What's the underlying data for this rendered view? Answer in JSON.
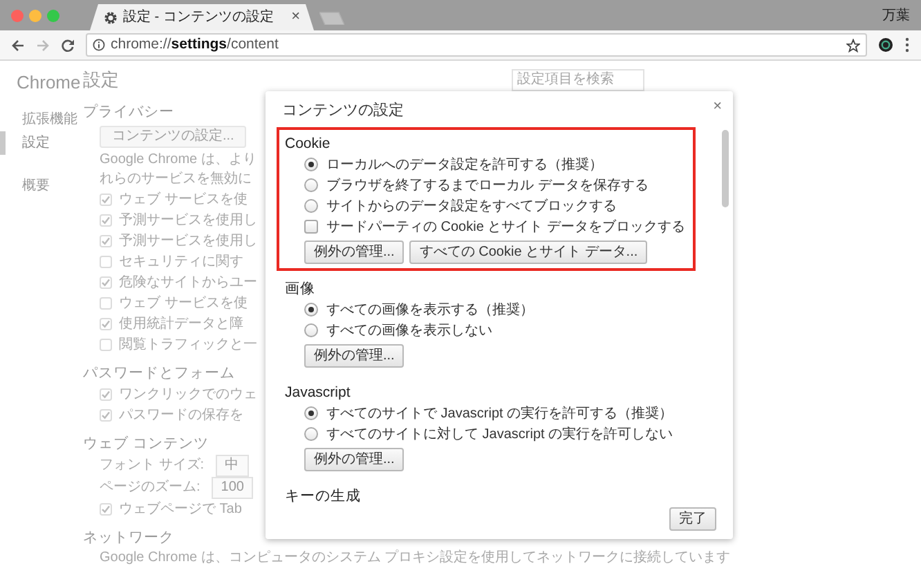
{
  "browser": {
    "tab": {
      "title": "設定 - コンテンツの設定",
      "close": "×"
    },
    "profile_name": "万葉",
    "address": "chrome://**settings**/content"
  },
  "sidebar": {
    "title": "Chrome",
    "items": [
      {
        "label": "拡張機能",
        "selected": false
      },
      {
        "label": "設定",
        "selected": true
      },
      {
        "label": "概要",
        "selected": false
      }
    ]
  },
  "page": {
    "title": "設定",
    "search": {
      "placeholder": "設定項目を検索"
    },
    "sections": [
      {
        "heading": "プライバシー",
        "items": [
          {
            "kind": "button",
            "label": "コンテンツの設定..."
          },
          {
            "kind": "text",
            "text": "Google Chrome は、より"
          },
          {
            "kind": "text",
            "text": "れらのサービスを無効に"
          },
          {
            "kind": "checkbox",
            "label": "ウェブ サービスを使",
            "checked": true
          },
          {
            "kind": "checkbox",
            "label": "予測サービスを使用し",
            "checked": true
          },
          {
            "kind": "checkbox",
            "label": "予測サービスを使用し",
            "checked": true
          },
          {
            "kind": "checkbox",
            "label": "セキュリティに関す",
            "checked": false
          },
          {
            "kind": "checkbox",
            "label": "危険なサイトからユー",
            "checked": true
          },
          {
            "kind": "checkbox",
            "label": "ウェブ サービスを使",
            "checked": false
          },
          {
            "kind": "checkbox",
            "label": "使用統計データと障",
            "checked": true
          },
          {
            "kind": "checkbox",
            "label": "閲覧トラフィックと一",
            "checked": false
          }
        ]
      },
      {
        "heading": "パスワードとフォーム",
        "items": [
          {
            "kind": "checkbox",
            "label": "ワンクリックでのウェ",
            "checked": true
          },
          {
            "kind": "checkbox",
            "label": "パスワードの保存を",
            "checked": true
          }
        ]
      },
      {
        "heading": "ウェブ コンテンツ",
        "items": [
          {
            "kind": "select",
            "label": "フォント サイズ:",
            "value": "中"
          },
          {
            "kind": "select",
            "label": "ページのズーム:",
            "value": "100"
          },
          {
            "kind": "checkbox",
            "label": "ウェブページで Tab",
            "checked": true
          }
        ]
      },
      {
        "heading": "ネットワーク",
        "items": [
          {
            "kind": "text",
            "text": "Google Chrome は、コンピュータのシステム プロキシ設定を使用してネットワークに接続しています"
          }
        ]
      }
    ]
  },
  "dialog": {
    "title": "コンテンツの設定",
    "close": "×",
    "groups": [
      {
        "title": "Cookie",
        "highlighted": true,
        "options": [
          {
            "kind": "radio",
            "label": "ローカルへのデータ設定を許可する（推奨）",
            "selected": true
          },
          {
            "kind": "radio",
            "label": "ブラウザを終了するまでローカル データを保存する",
            "selected": false
          },
          {
            "kind": "radio",
            "label": "サイトからのデータ設定をすべてブロックする",
            "selected": false
          },
          {
            "kind": "checkbox",
            "label": "サードパーティの Cookie とサイト データをブロックする",
            "checked": false
          }
        ],
        "buttons": [
          "例外の管理...",
          "すべての Cookie とサイト データ..."
        ]
      },
      {
        "title": "画像",
        "highlighted": false,
        "options": [
          {
            "kind": "radio",
            "label": "すべての画像を表示する（推奨）",
            "selected": true
          },
          {
            "kind": "radio",
            "label": "すべての画像を表示しない",
            "selected": false
          }
        ],
        "buttons": [
          "例外の管理..."
        ]
      },
      {
        "title": "Javascript",
        "highlighted": false,
        "options": [
          {
            "kind": "radio",
            "label": "すべてのサイトで Javascript の実行を許可する（推奨）",
            "selected": true
          },
          {
            "kind": "radio",
            "label": "すべてのサイトに対して Javascript の実行を許可しない",
            "selected": false
          }
        ],
        "buttons": [
          "例外の管理..."
        ]
      },
      {
        "title": "キーの生成",
        "highlighted": false
      }
    ],
    "done_button": "完了"
  }
}
